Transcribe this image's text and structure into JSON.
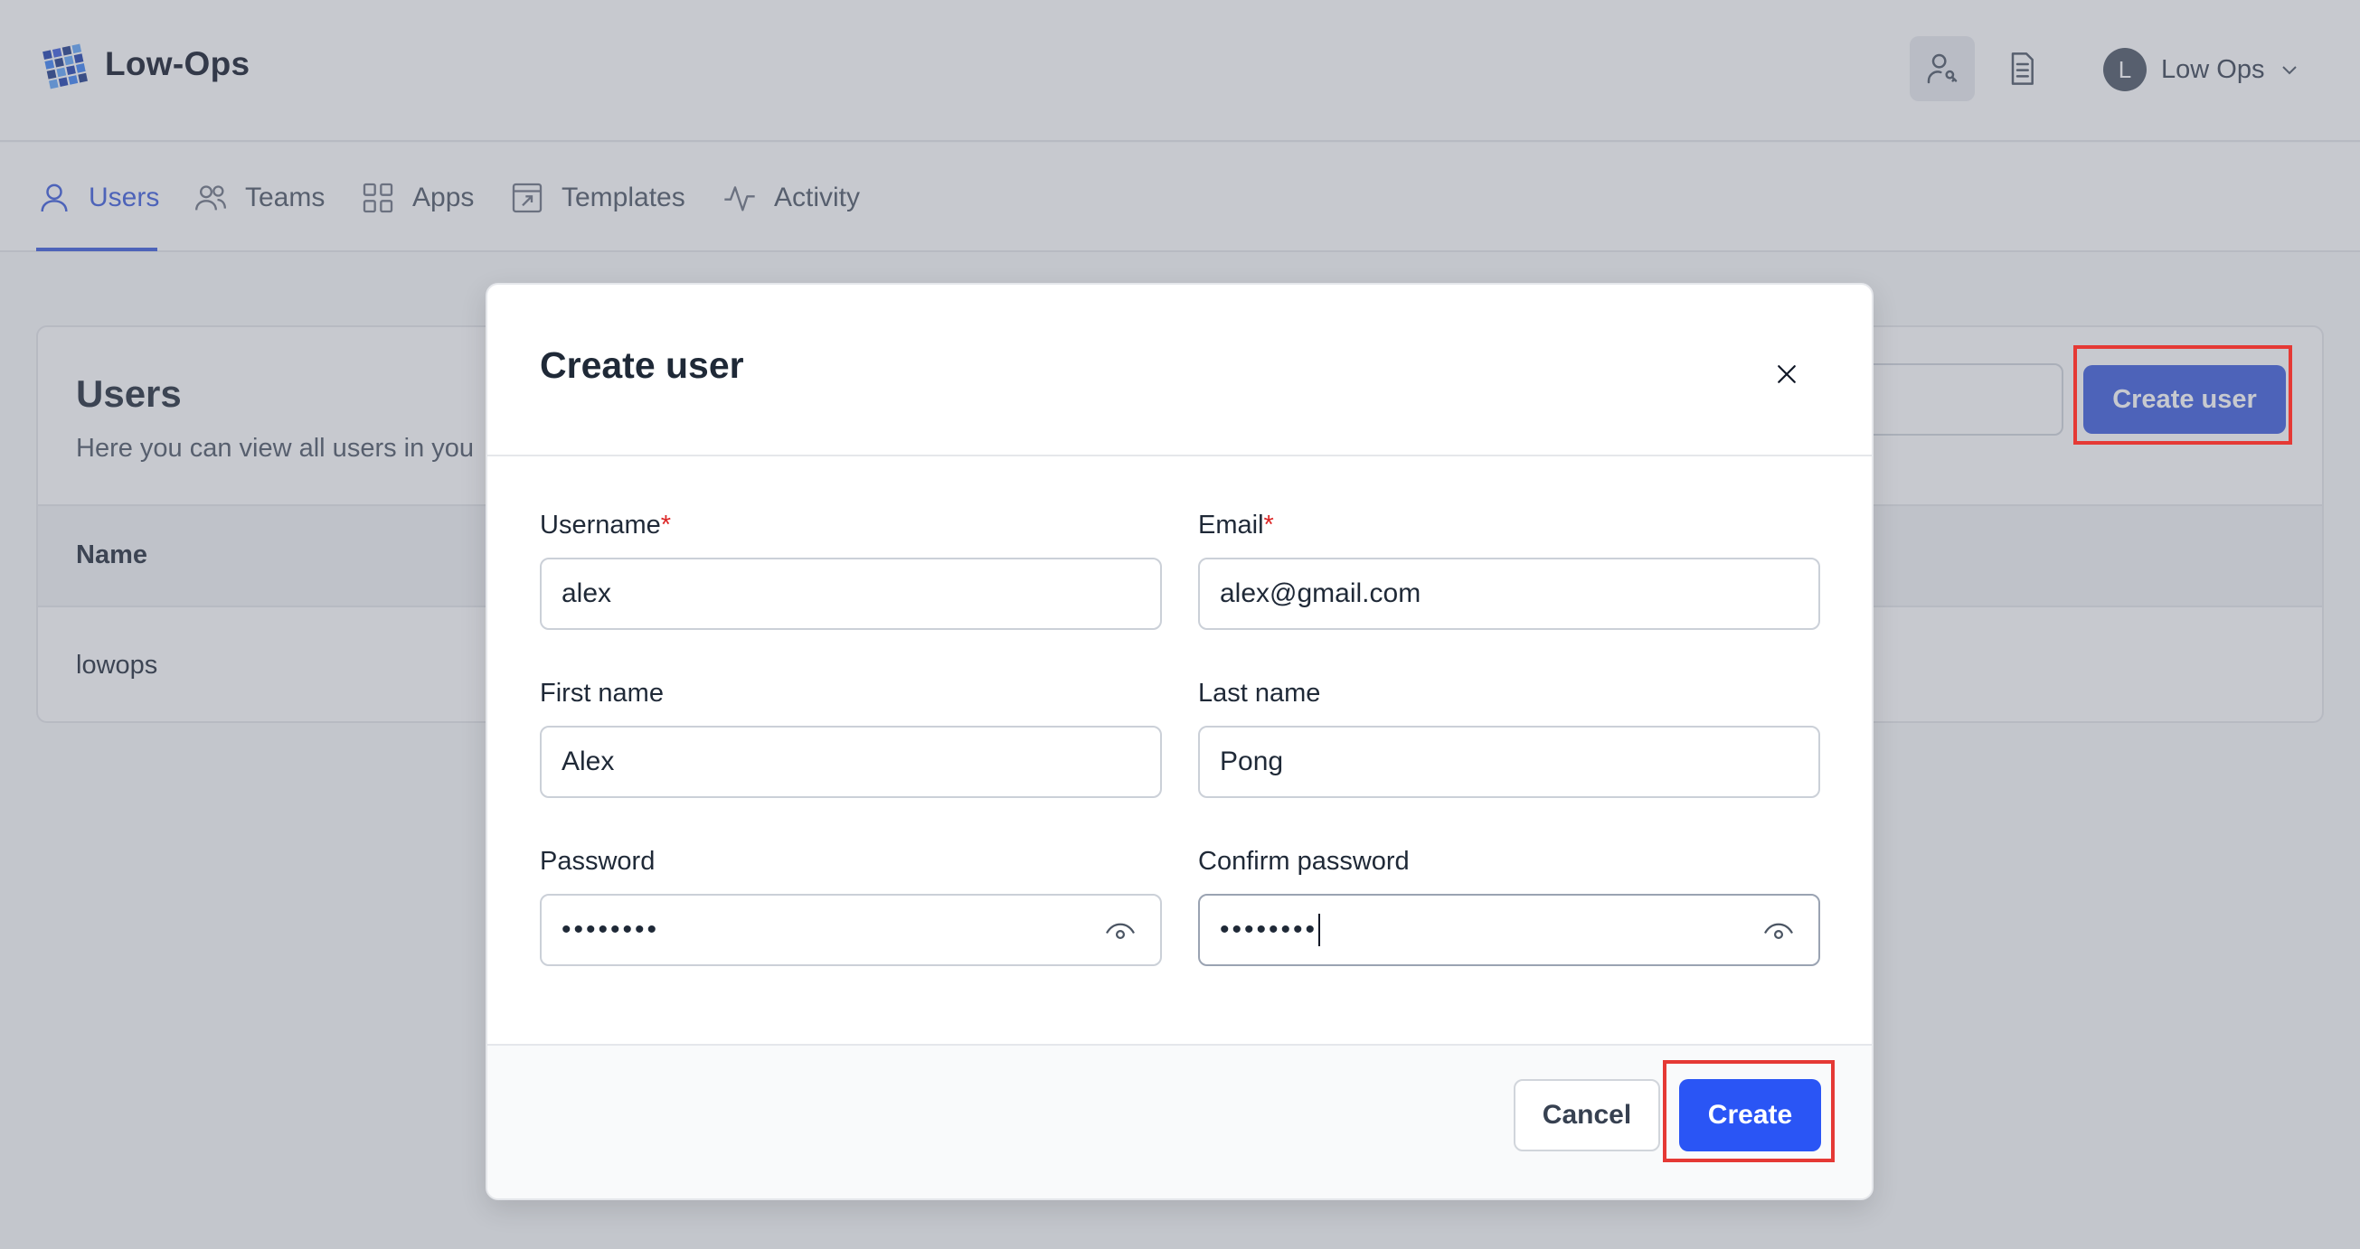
{
  "app": {
    "brand": "Low-Ops"
  },
  "header": {
    "user_initial": "L",
    "user_name": "Low Ops"
  },
  "nav": {
    "tabs": [
      {
        "label": "Users",
        "icon": "user-icon",
        "active": true
      },
      {
        "label": "Teams",
        "icon": "users-icon",
        "active": false
      },
      {
        "label": "Apps",
        "icon": "grid-icon",
        "active": false
      },
      {
        "label": "Templates",
        "icon": "template-icon",
        "active": false
      },
      {
        "label": "Activity",
        "icon": "activity-icon",
        "active": false
      }
    ]
  },
  "users_page": {
    "title": "Users",
    "subtitle": "Here you can view all users in you",
    "create_user_label": "Create user",
    "table": {
      "columns": [
        "Name"
      ],
      "rows": [
        [
          "lowops"
        ]
      ]
    }
  },
  "modal": {
    "title": "Create user",
    "fields": {
      "username": {
        "label": "Username",
        "required_mark": "*",
        "value": "alex"
      },
      "email": {
        "label": "Email",
        "required_mark": "*",
        "value": "alex@gmail.com"
      },
      "first_name": {
        "label": "First name",
        "value": "Alex"
      },
      "last_name": {
        "label": "Last name",
        "value": "Pong"
      },
      "password": {
        "label": "Password",
        "value": "••••••••"
      },
      "confirm_password": {
        "label": "Confirm password",
        "value": "••••••••"
      }
    },
    "cancel_label": "Cancel",
    "create_label": "Create"
  },
  "colors": {
    "accent": "#3b5bdb",
    "primary_button": "#2a55f5",
    "highlight": "#e53935",
    "required": "#dc2626"
  }
}
